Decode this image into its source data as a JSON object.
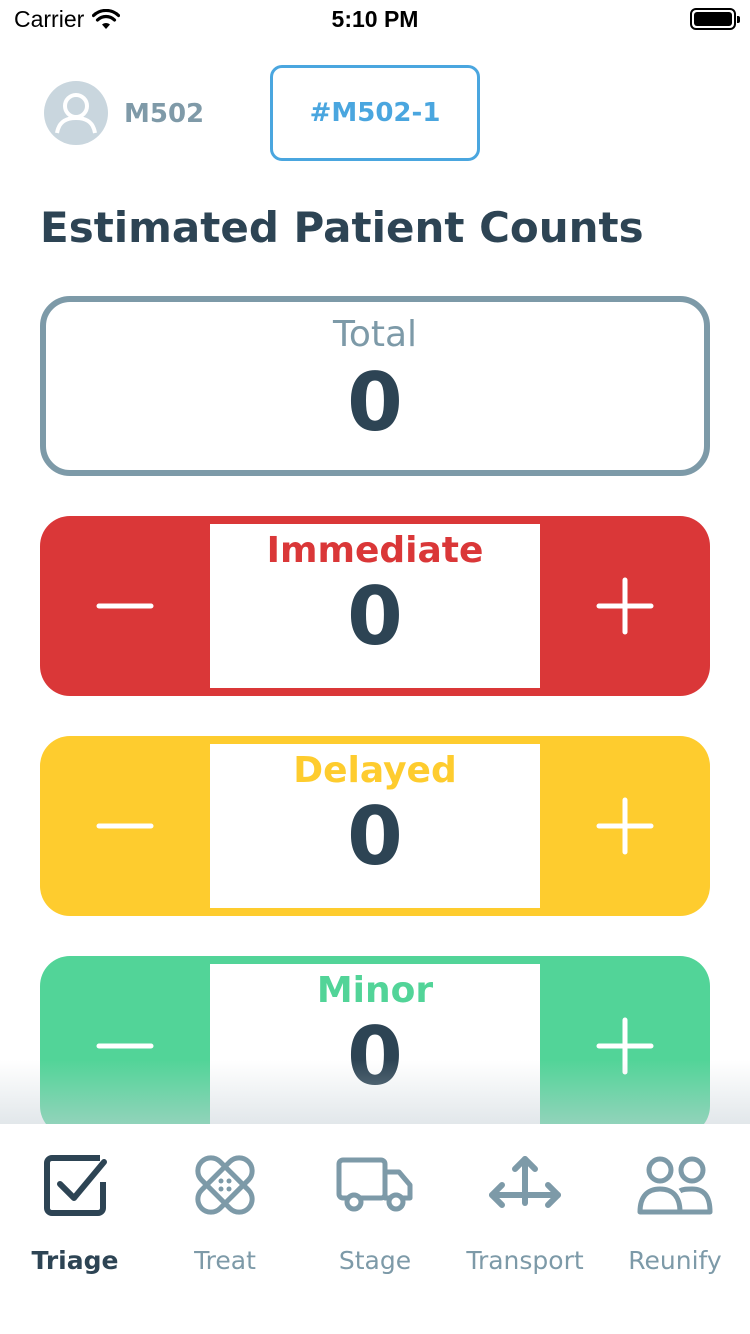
{
  "status_bar": {
    "carrier": "Carrier",
    "time": "5:10 PM"
  },
  "header": {
    "user_id": "M502",
    "incident_tab": "#M502-1"
  },
  "title": "Estimated Patient Counts",
  "total": {
    "label": "Total",
    "value": "0"
  },
  "counters": [
    {
      "label": "Immediate",
      "value": "0",
      "color": "#da3738"
    },
    {
      "label": "Delayed",
      "value": "0",
      "color": "#fecc2e"
    },
    {
      "label": "Minor",
      "value": "0",
      "color": "#52d498"
    }
  ],
  "tabs": [
    {
      "label": "Triage",
      "icon": "checkbox-icon",
      "active": true
    },
    {
      "label": "Treat",
      "icon": "bandage-icon",
      "active": false
    },
    {
      "label": "Stage",
      "icon": "truck-icon",
      "active": false
    },
    {
      "label": "Transport",
      "icon": "arrows-icon",
      "active": false
    },
    {
      "label": "Reunify",
      "icon": "people-icon",
      "active": false
    }
  ]
}
